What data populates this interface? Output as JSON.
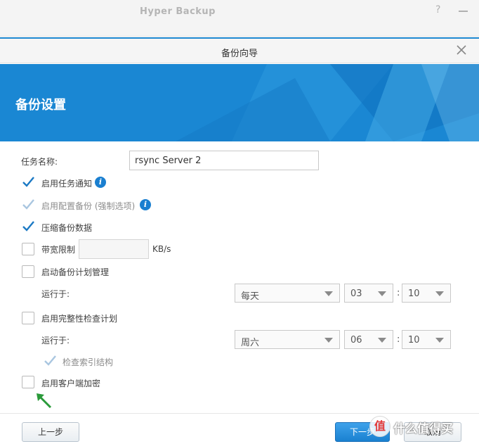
{
  "app": {
    "title": "Hyper Backup",
    "help_icon": "question-mark-icon",
    "minimize_icon": "minimize-icon"
  },
  "dialog": {
    "title": "备份向导",
    "close_icon": "close-icon"
  },
  "banner": {
    "title": "备份设置",
    "color": "#1a87d3"
  },
  "form": {
    "task_name_label": "任务名称:",
    "task_name_value": "rsync Server 2",
    "notify": {
      "label": "启用任务通知",
      "checked": true
    },
    "config_backup": {
      "label": "启用配置备份 (强制选项)",
      "checked": true,
      "disabled": true
    },
    "compress": {
      "label": "压缩备份数据",
      "checked": true
    },
    "bandwidth": {
      "label": "带宽限制",
      "checked": false,
      "value": "",
      "unit": "KB/s"
    },
    "schedule": {
      "label": "启动备份计划管理",
      "checked": false,
      "run_label": "运行于:",
      "day": "每天",
      "hour": "03",
      "minute": "10"
    },
    "integrity": {
      "label": "启用完整性检查计划",
      "checked": false,
      "run_label": "运行于:",
      "day": "周六",
      "hour": "06",
      "minute": "10",
      "index_check": {
        "label": "检查索引结构",
        "checked": true,
        "disabled": true
      }
    },
    "encryption": {
      "label": "启用客户端加密",
      "checked": false
    },
    "colon": ":"
  },
  "footer": {
    "prev_label": "上一步",
    "next_label": "下一步",
    "cancel_label": "取消"
  },
  "watermark": {
    "badge": "值",
    "text": "什么值得买"
  },
  "colors": {
    "accent": "#1a7fd0",
    "check": "#1b79c4",
    "check_disabled": "#a9c6e0",
    "arrow": "#2a9a3a"
  }
}
